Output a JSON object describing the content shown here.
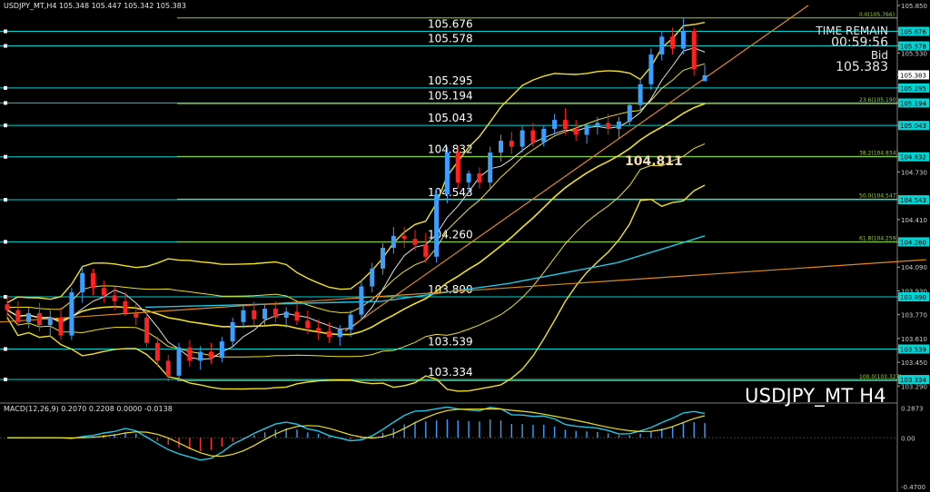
{
  "window": {
    "header": "USDJPY_MT,H4  105.348 105.447 105.342 105.383"
  },
  "info_panel": {
    "time_remain_label": "TIME REMAIN",
    "time_remain": "00:59:56",
    "bid_label": "Bid",
    "bid_value": "105.383"
  },
  "symbol_label": "USDJPY_MT H4",
  "macd_header": "MACD(12,26,9) 0.2070 0.2208 0.0000 -0.0138",
  "colors": {
    "background": "#000000",
    "bull_candle": "#3aa0ff",
    "bear_candle": "#ff2020",
    "level_line": "#00d5d5",
    "fib_line": "#9acd32",
    "bollinger": "#f0e020",
    "ma_teal": "#1ec8e6",
    "trend_orange": "#e08a1a",
    "highlight_box": "#00d5d5"
  },
  "chart_data": [
    {
      "type": "candlestick",
      "symbol": "USDJPY_MT",
      "timeframe": "H4",
      "ylim": [
        103.2,
        105.85
      ],
      "y_ticks": [
        "105.850",
        "105.676",
        "105.578",
        "105.530",
        "105.383",
        "105.295",
        "105.194",
        "105.043",
        "104.832",
        "104.730",
        "104.543",
        "104.410",
        "104.260",
        "104.090",
        "103.930",
        "103.890",
        "103.770",
        "103.610",
        "103.539",
        "103.450",
        "103.334",
        "103.290"
      ],
      "horizontal_levels": [
        {
          "value": 105.676,
          "label": "105.676"
        },
        {
          "value": 105.578,
          "label": "105.578"
        },
        {
          "value": 105.295,
          "label": "105.295"
        },
        {
          "value": 105.194,
          "label": "105.194"
        },
        {
          "value": 105.043,
          "label": "105.043"
        },
        {
          "value": 104.832,
          "label": "104.832"
        },
        {
          "value": 104.543,
          "label": "104.543"
        },
        {
          "value": 104.26,
          "label": "104.260"
        },
        {
          "value": 103.89,
          "label": "103.890"
        },
        {
          "value": 103.539,
          "label": "103.539"
        },
        {
          "value": 103.334,
          "label": "103.334"
        }
      ],
      "fibonacci": [
        {
          "level": "0.0",
          "value": 105.766,
          "label": "0.0(105.766)"
        },
        {
          "level": "23.6",
          "value": 105.19,
          "label": "23.6(105.190)"
        },
        {
          "level": "38.2",
          "value": 104.834,
          "label": "38.2(104.834)"
        },
        {
          "level": "50.0",
          "value": 104.547,
          "label": "50.0(104.547)"
        },
        {
          "level": "61.8",
          "value": 104.259,
          "label": "61.8(104.259)"
        },
        {
          "level": "100.0",
          "value": 103.327,
          "label": "100.0(103.327)"
        }
      ],
      "annotation": {
        "text": "104.811",
        "value": 104.811
      },
      "current_price": 105.383,
      "candles": [
        [
          103.84,
          103.9,
          103.75,
          103.8
        ],
        [
          103.8,
          103.86,
          103.7,
          103.72
        ],
        [
          103.72,
          103.82,
          103.68,
          103.78
        ],
        [
          103.78,
          103.85,
          103.66,
          103.7
        ],
        [
          103.7,
          103.8,
          103.62,
          103.75
        ],
        [
          103.75,
          103.82,
          103.6,
          103.63
        ],
        [
          103.63,
          103.95,
          103.6,
          103.92
        ],
        [
          103.92,
          104.1,
          103.85,
          104.05
        ],
        [
          104.05,
          104.08,
          103.9,
          103.95
        ],
        [
          103.95,
          104.0,
          103.85,
          103.9
        ],
        [
          103.9,
          103.96,
          103.8,
          103.86
        ],
        [
          103.86,
          103.92,
          103.76,
          103.78
        ],
        [
          103.78,
          103.84,
          103.7,
          103.75
        ],
        [
          103.75,
          103.8,
          103.55,
          103.58
        ],
        [
          103.58,
          103.62,
          103.42,
          103.46
        ],
        [
          103.46,
          103.5,
          103.32,
          103.36
        ],
        [
          103.36,
          103.58,
          103.33,
          103.55
        ],
        [
          103.55,
          103.6,
          103.42,
          103.46
        ],
        [
          103.46,
          103.56,
          103.4,
          103.52
        ],
        [
          103.52,
          103.58,
          103.44,
          103.48
        ],
        [
          103.48,
          103.62,
          103.45,
          103.59
        ],
        [
          103.59,
          103.75,
          103.56,
          103.72
        ],
        [
          103.72,
          103.84,
          103.68,
          103.8
        ],
        [
          103.8,
          103.86,
          103.7,
          103.74
        ],
        [
          103.74,
          103.84,
          103.7,
          103.81
        ],
        [
          103.81,
          103.86,
          103.72,
          103.75
        ],
        [
          103.75,
          103.82,
          103.68,
          103.79
        ],
        [
          103.79,
          103.84,
          103.7,
          103.73
        ],
        [
          103.73,
          103.8,
          103.64,
          103.68
        ],
        [
          103.68,
          103.74,
          103.6,
          103.66
        ],
        [
          103.66,
          103.72,
          103.58,
          103.62
        ],
        [
          103.62,
          103.7,
          103.56,
          103.67
        ],
        [
          103.67,
          103.8,
          103.62,
          103.77
        ],
        [
          103.77,
          104.0,
          103.74,
          103.96
        ],
        [
          103.96,
          104.12,
          103.92,
          104.08
        ],
        [
          104.08,
          104.25,
          104.04,
          104.22
        ],
        [
          104.22,
          104.36,
          104.18,
          104.3
        ],
        [
          104.3,
          104.36,
          104.22,
          104.28
        ],
        [
          104.28,
          104.34,
          104.2,
          104.24
        ],
        [
          104.24,
          104.32,
          104.12,
          104.16
        ],
        [
          104.16,
          104.62,
          104.12,
          104.58
        ],
        [
          104.58,
          104.9,
          104.52,
          104.86
        ],
        [
          104.86,
          104.9,
          104.62,
          104.66
        ],
        [
          104.66,
          104.74,
          104.58,
          104.72
        ],
        [
          104.72,
          104.76,
          104.62,
          104.66
        ],
        [
          104.66,
          104.9,
          104.62,
          104.86
        ],
        [
          104.86,
          104.98,
          104.8,
          104.94
        ],
        [
          104.94,
          105.0,
          104.85,
          104.9
        ],
        [
          104.9,
          105.04,
          104.86,
          105.01
        ],
        [
          105.01,
          105.06,
          104.9,
          104.93
        ],
        [
          104.93,
          105.04,
          104.9,
          105.02
        ],
        [
          105.02,
          105.12,
          104.98,
          105.08
        ],
        [
          105.08,
          105.16,
          104.98,
          105.02
        ],
        [
          105.02,
          105.08,
          104.94,
          104.98
        ],
        [
          104.98,
          105.06,
          104.92,
          105.04
        ],
        [
          105.04,
          105.1,
          104.98,
          105.06
        ],
        [
          105.06,
          105.12,
          104.98,
          105.02
        ],
        [
          105.02,
          105.1,
          104.96,
          105.07
        ],
        [
          105.07,
          105.2,
          105.04,
          105.18
        ],
        [
          105.18,
          105.36,
          105.14,
          105.32
        ],
        [
          105.32,
          105.56,
          105.28,
          105.52
        ],
        [
          105.52,
          105.68,
          105.48,
          105.64
        ],
        [
          105.64,
          105.7,
          105.52,
          105.56
        ],
        [
          105.56,
          105.77,
          105.52,
          105.68
        ],
        [
          105.68,
          105.7,
          105.38,
          105.42
        ],
        [
          105.34,
          105.45,
          105.34,
          105.38
        ]
      ]
    },
    {
      "type": "macd",
      "params": "MACD(12,26,9)",
      "values": {
        "macd": 0.207,
        "signal": 0.2208,
        "hist_a": 0.0,
        "hist_b": -0.0138
      },
      "y_ticks": [
        "0.2873",
        "0.00",
        "-0.4700"
      ],
      "ylim": [
        -0.47,
        0.3
      ]
    }
  ]
}
